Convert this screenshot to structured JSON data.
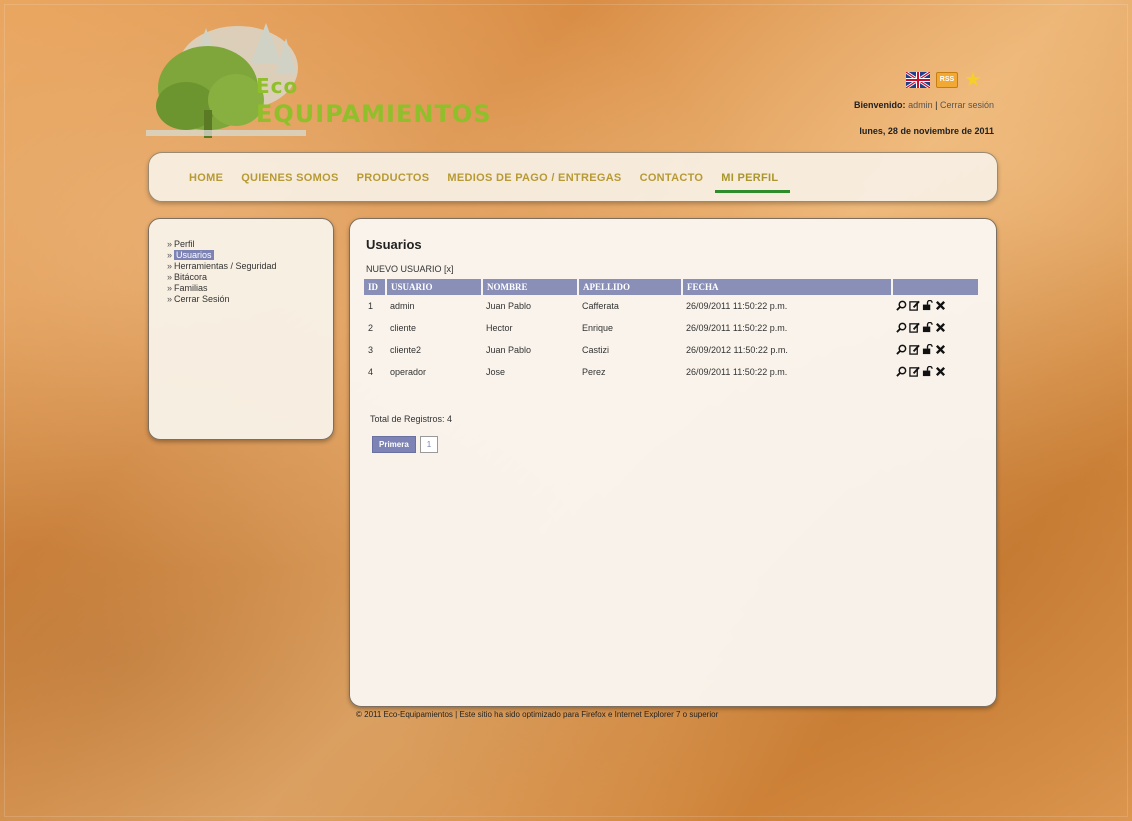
{
  "brand": {
    "line1": "Eco",
    "line2": "EQUIPAMIENTOS"
  },
  "header": {
    "welcome_label": "Bienvenido:",
    "username": "admin",
    "separator": "|",
    "logout": "Cerrar sesión",
    "date": "lunes, 28 de noviembre de 2011",
    "rss_label": "RSS"
  },
  "nav": {
    "items": [
      "HOME",
      "QUIENES SOMOS",
      "PRODUCTOS",
      "MEDIOS DE PAGO / ENTREGAS",
      "CONTACTO",
      "MI PERFIL"
    ],
    "active": "MI PERFIL"
  },
  "sidebar": {
    "items": [
      "Perfil",
      "Usuarios",
      "Herramientas / Seguridad",
      "Bitácora",
      "Familias",
      "Cerrar Sesión"
    ],
    "active": "Usuarios"
  },
  "main": {
    "title": "Usuarios",
    "new_user": "NUEVO USUARIO [x]",
    "columns": [
      "ID",
      "USUARIO",
      "NOMBRE",
      "APELLIDO",
      "FECHA",
      ""
    ],
    "rows": [
      [
        "1",
        "admin",
        "Juan Pablo",
        "Cafferata",
        "26/09/2011 11:50:22 p.m."
      ],
      [
        "2",
        "cliente",
        "Hector",
        "Enrique",
        "26/09/2011 11:50:22 p.m."
      ],
      [
        "3",
        "cliente2",
        "Juan Pablo",
        "Castizi",
        "26/09/2012 11:50:22 p.m."
      ],
      [
        "4",
        "operador",
        "Jose",
        "Perez",
        "26/09/2011 11:50:22 p.m."
      ]
    ],
    "total": "Total de Registros: 4",
    "pager": {
      "first": "Primera",
      "page": "1"
    }
  },
  "footer": "© 2011 Eco-Equipamientos | Este sitio ha sido optimizado para Firefox e Internet Explorer 7 o superior",
  "colors": {
    "header_bg": "#8a8fb8",
    "nav_text": "#b79a34",
    "active_underline": "#2e8c2a",
    "logo_green": "#8fbf2a"
  },
  "icons": [
    "view-icon",
    "edit-icon",
    "unlock-icon",
    "delete-icon"
  ]
}
